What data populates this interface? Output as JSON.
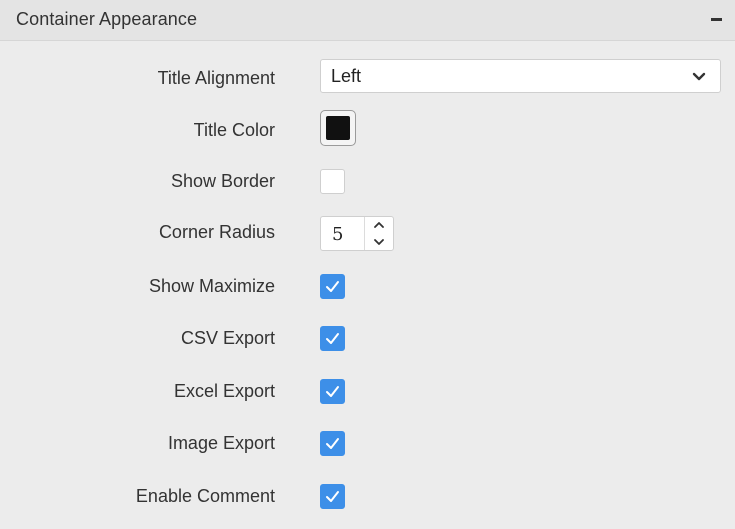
{
  "header": {
    "title": "Container Appearance",
    "collapse_icon": "minus-icon"
  },
  "fields": {
    "title_alignment": {
      "label": "Title Alignment",
      "value": "Left"
    },
    "title_color": {
      "label": "Title Color",
      "value": "#111111"
    },
    "show_border": {
      "label": "Show Border",
      "checked": false
    },
    "corner_radius": {
      "label": "Corner Radius",
      "value": "5"
    },
    "show_maximize": {
      "label": "Show Maximize",
      "checked": true
    },
    "csv_export": {
      "label": "CSV Export",
      "checked": true
    },
    "excel_export": {
      "label": "Excel Export",
      "checked": true
    },
    "image_export": {
      "label": "Image Export",
      "checked": true
    },
    "enable_comment": {
      "label": "Enable Comment",
      "checked": true
    }
  },
  "colors": {
    "accent": "#3d8fe8",
    "background": "#ececec",
    "header_bg": "#e4e4e4",
    "text": "#333333"
  }
}
